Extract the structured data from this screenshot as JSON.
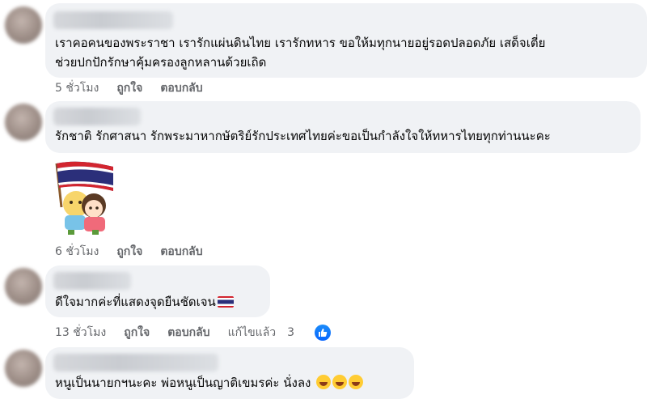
{
  "comments": [
    {
      "text_lines": [
        "เราคอคนของพระราชา เรารักแผ่นดินไทย เรารักทหาร ขอให้มทุกนายอยู่รอดปลอดภัย เสด็จเตี่ย",
        "ช่วยปกปักรักษาคุ้มครองลูกหลานด้วยเถิด"
      ],
      "time": "5 ชั่วโมง",
      "like": "ถูกใจ",
      "reply": "ตอบกลับ"
    },
    {
      "text_lines": [
        "รักชาติ รักศาสนา รักพระมาหากษัตริย์รักประเทศไทยค่ะขอเป็นกำลังใจให้ทหารไทยทุกท่านนะคะ"
      ],
      "sticker": "thai-flag-hug-sticker",
      "time": "6 ชั่วโมง",
      "like": "ถูกใจ",
      "reply": "ตอบกลับ"
    },
    {
      "text_lines": [
        "ดีใจมากค่ะที่แสดงจุดยืนชัดเจน"
      ],
      "emoji": "thai-flag",
      "time": "13 ชั่วโมง",
      "like": "ถูกใจ",
      "reply": "ตอบกลับ",
      "edited": "แก้ไขแล้ว",
      "like_count": "3"
    },
    {
      "text_lines": [
        "หนูเป็นนายกฯนะคะ พ่อหนูเป็นญาติเขมรค่ะ นั่งลง"
      ],
      "emoji": "rolling-laughing"
    }
  ],
  "colors": {
    "bubble": "#f0f2f5",
    "meta_text": "#65676b",
    "like_blue": "#0866ff"
  }
}
